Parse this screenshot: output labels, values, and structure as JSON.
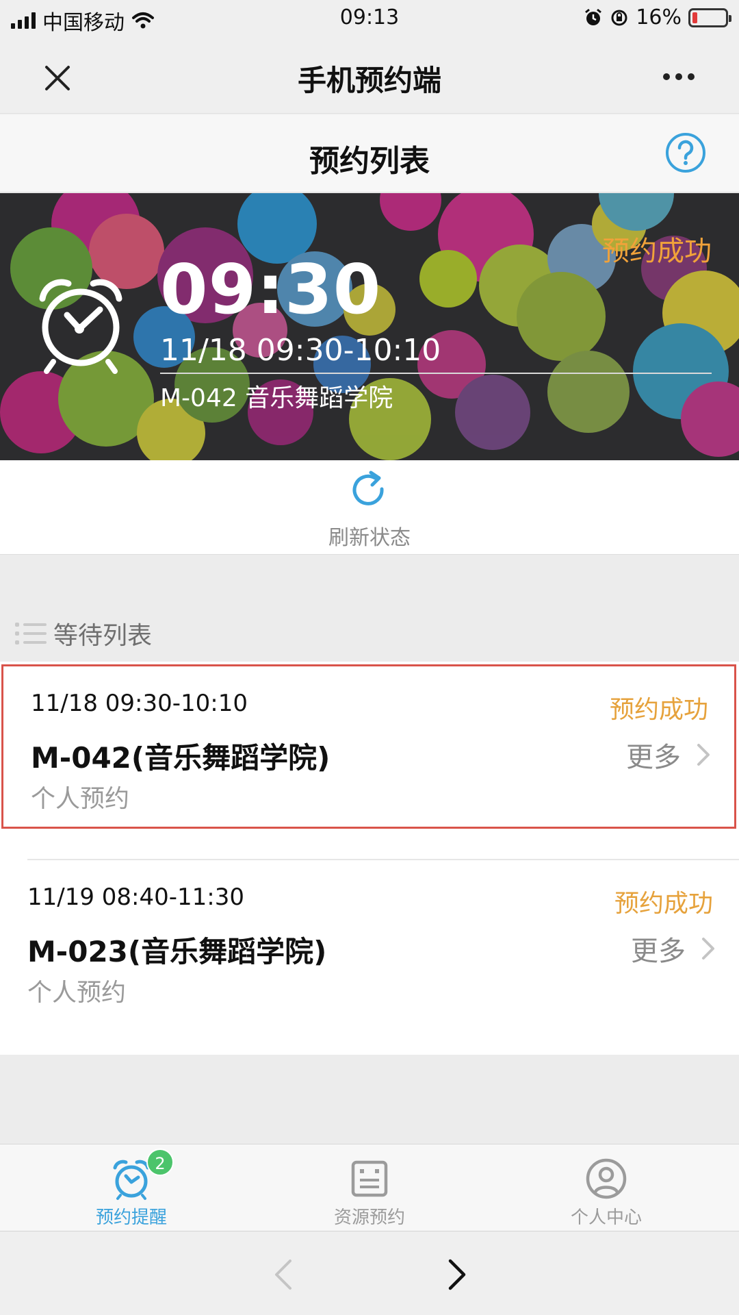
{
  "status_bar": {
    "carrier": "中国移动",
    "time": "09:13",
    "battery_text": "16%",
    "battery_level": 0.16
  },
  "nav": {
    "title": "手机预约端"
  },
  "header": {
    "title": "预约列表"
  },
  "banner": {
    "status": "预约成功",
    "time": "09:30",
    "range": "11/18 09:30-10:10",
    "room": "M-042 音乐舞蹈学院"
  },
  "refresh": {
    "label": "刷新状态"
  },
  "section": {
    "title": "等待列表"
  },
  "cards": [
    {
      "time": "11/18 09:30-10:10",
      "status": "预约成功",
      "room": "M-042(音乐舞蹈学院)",
      "type": "个人预约",
      "more": "更多"
    },
    {
      "time": "11/19 08:40-11:30",
      "status": "预约成功",
      "room": "M-023(音乐舞蹈学院)",
      "type": "个人预约",
      "more": "更多"
    }
  ],
  "tabs": [
    {
      "label": "预约提醒",
      "icon": "alarm-clock-icon",
      "badge": "2",
      "active": true
    },
    {
      "label": "资源预约",
      "icon": "resource-board-icon",
      "active": false
    },
    {
      "label": "个人中心",
      "icon": "user-icon",
      "active": false
    }
  ],
  "colors": {
    "accent_blue": "#3aa2dc",
    "status_orange": "#e6a23c",
    "highlight_red": "#d9534a",
    "badge_green": "#4cc46b"
  }
}
